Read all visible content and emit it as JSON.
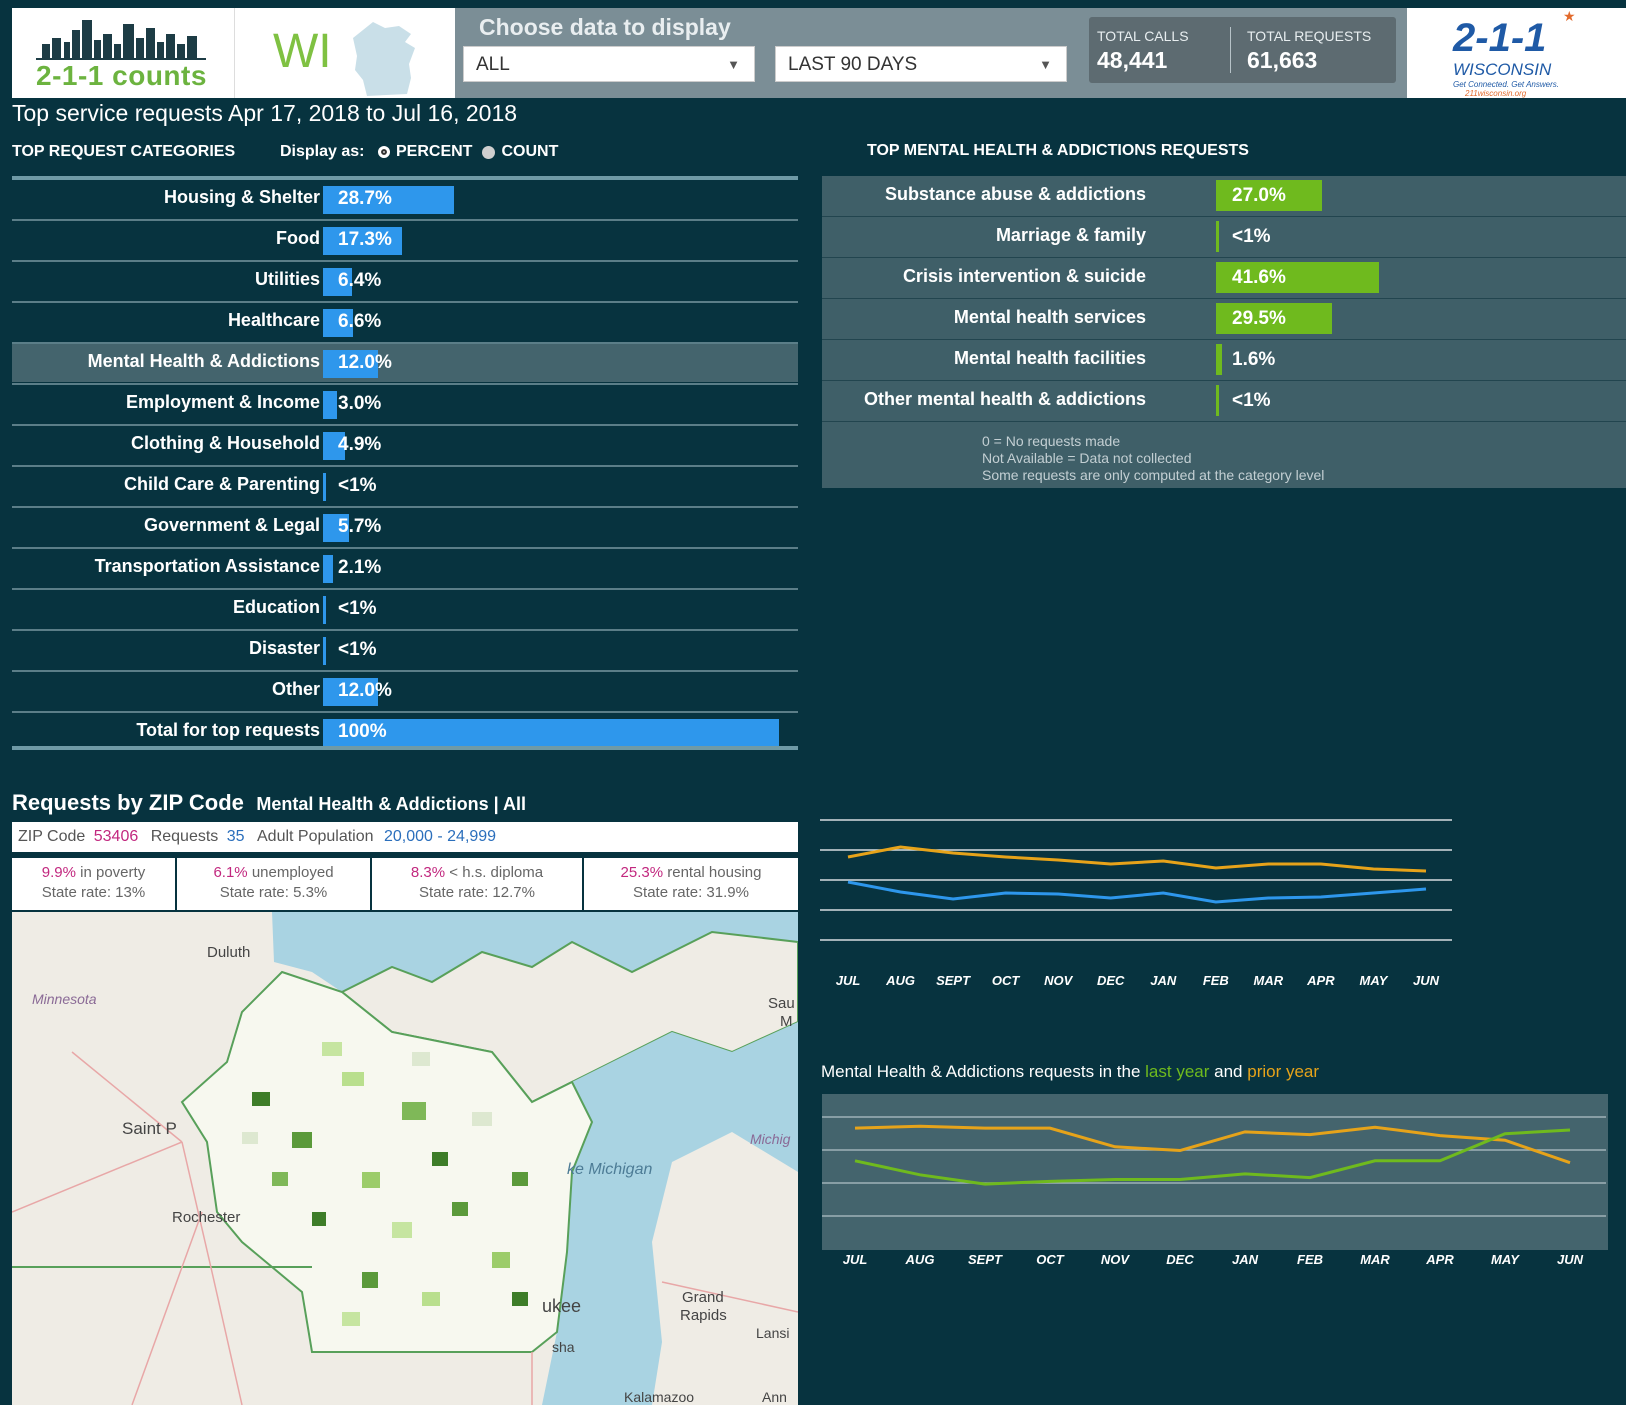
{
  "header": {
    "logo_text": "2-1-1 counts",
    "state_abbr": "WI",
    "choose_label": "Choose data to display",
    "category_select": "ALL",
    "period_select": "LAST 90 DAYS",
    "total_calls_label": "TOTAL CALLS",
    "total_calls_value": "48,441",
    "total_requests_label": "TOTAL REQUESTS",
    "total_requests_value": "61,663",
    "brand_number": "2-1-1",
    "brand_state": "WISCONSIN",
    "brand_tagline": "Get Connected. Get Answers.",
    "brand_url": "211wisconsin.org"
  },
  "page_title": "Top service requests Apr 17, 2018 to Jul 16, 2018",
  "categories_section": {
    "title": "TOP REQUEST CATEGORIES",
    "display_as_label": "Display as:",
    "option_percent": "PERCENT",
    "option_count": "COUNT",
    "selected": "PERCENT",
    "items": [
      {
        "label": "Housing & Shelter",
        "value": "28.7%",
        "fraction": 0.287,
        "highlight": false
      },
      {
        "label": "Food",
        "value": "17.3%",
        "fraction": 0.173,
        "highlight": false
      },
      {
        "label": "Utilities",
        "value": "6.4%",
        "fraction": 0.064,
        "highlight": false
      },
      {
        "label": "Healthcare",
        "value": "6.6%",
        "fraction": 0.066,
        "highlight": false
      },
      {
        "label": "Mental Health & Addictions",
        "value": "12.0%",
        "fraction": 0.12,
        "highlight": true
      },
      {
        "label": "Employment & Income",
        "value": "3.0%",
        "fraction": 0.03,
        "highlight": false
      },
      {
        "label": "Clothing & Household",
        "value": "4.9%",
        "fraction": 0.049,
        "highlight": false
      },
      {
        "label": "Child Care & Parenting",
        "value": "<1%",
        "fraction": 0.005,
        "highlight": false
      },
      {
        "label": "Government & Legal",
        "value": "5.7%",
        "fraction": 0.057,
        "highlight": false
      },
      {
        "label": "Transportation Assistance",
        "value": "2.1%",
        "fraction": 0.021,
        "highlight": false
      },
      {
        "label": "Education",
        "value": "<1%",
        "fraction": 0.005,
        "highlight": false
      },
      {
        "label": "Disaster",
        "value": "<1%",
        "fraction": 0.005,
        "highlight": false
      },
      {
        "label": "Other",
        "value": "12.0%",
        "fraction": 0.12,
        "highlight": false
      },
      {
        "label": "Total for top requests",
        "value": "100%",
        "fraction": 1.0,
        "highlight": false
      }
    ]
  },
  "mental_health_section": {
    "title": "TOP MENTAL HEALTH & ADDICTIONS REQUESTS",
    "items": [
      {
        "label": "Substance abuse & addictions",
        "value": "27.0%",
        "fraction": 0.27
      },
      {
        "label": "Marriage & family",
        "value": "<1%",
        "fraction": 0.005
      },
      {
        "label": "Crisis intervention & suicide",
        "value": "41.6%",
        "fraction": 0.416
      },
      {
        "label": "Mental health services",
        "value": "29.5%",
        "fraction": 0.295
      },
      {
        "label": "Mental health facilities",
        "value": "1.6%",
        "fraction": 0.016
      },
      {
        "label": "Other mental health & addictions",
        "value": "<1%",
        "fraction": 0.005
      }
    ],
    "notes": [
      "0 = No requests made",
      "Not Available = Data not collected",
      "Some requests are only computed at the category level"
    ]
  },
  "zip_section": {
    "title": "Requests by ZIP Code",
    "filter": "Mental Health & Addictions | All",
    "zip_label": "ZIP Code",
    "zip_value": "53406",
    "requests_label": "Requests",
    "requests_value": "35",
    "adult_pop_label": "Adult Population",
    "adult_pop_value": "20,000 - 24,999",
    "stats": [
      {
        "value": "9.9%",
        "label": "in poverty",
        "state": "State rate: 13%"
      },
      {
        "value": "6.1%",
        "label": "unemployed",
        "state": "State rate: 5.3%"
      },
      {
        "value": "8.3%",
        "label": "< h.s. diploma",
        "state": "State rate: 12.7%"
      },
      {
        "value": "25.3%",
        "label": "rental housing",
        "state": "State rate: 31.9%"
      }
    ]
  },
  "map_labels": {
    "duluth": "Duluth",
    "minnesota": "Minnesota",
    "saint_paul": "Saint P",
    "rochester": "Rochester",
    "lake_michigan": "ke Michigan",
    "michigan": "Michig",
    "milwaukee": "ukee",
    "kenosha": "sha",
    "grand_rapids_1": "Grand",
    "grand_rapids_2": "Rapids",
    "lansing": "Lansi",
    "kalamazoo": "Kalamazoo",
    "ann": "Ann",
    "sault_1": "Sau",
    "sault_2": "M"
  },
  "chart_top": {
    "type": "line",
    "categories": [
      "JUL",
      "AUG",
      "SEPT",
      "OCT",
      "NOV",
      "DEC",
      "JAN",
      "FEB",
      "MAR",
      "APR",
      "MAY",
      "JUN"
    ],
    "series": [
      {
        "color": "#e6a31a",
        "values": [
          83,
          93,
          87,
          83,
          80,
          76,
          79,
          72,
          76,
          76,
          71,
          69
        ]
      },
      {
        "color": "#2e97ec",
        "values": [
          58,
          48,
          41,
          47,
          46,
          42,
          47,
          38,
          42,
          43,
          47,
          51
        ]
      }
    ],
    "ylim": [
      0,
      120
    ],
    "grid": true
  },
  "chart_bottom": {
    "type": "line",
    "title_prefix": "Mental Health & Addictions requests in the",
    "title_last": "last year",
    "title_and": "and",
    "title_prior": "prior year",
    "categories": [
      "JUL",
      "AUG",
      "SEPT",
      "OCT",
      "NOV",
      "DEC",
      "JAN",
      "FEB",
      "MAR",
      "APR",
      "MAY",
      "JUN"
    ],
    "series": [
      {
        "name": "prior year",
        "color": "#e6a31a",
        "values": [
          122,
          124,
          122,
          122,
          102,
          98,
          118,
          115,
          123,
          114,
          109,
          85
        ]
      },
      {
        "name": "last year",
        "color": "#6fba1e",
        "values": [
          87,
          72,
          62,
          65,
          67,
          67,
          73,
          69,
          87,
          87,
          116,
          120
        ]
      }
    ],
    "ylim": [
      0,
      150
    ],
    "grid": true
  },
  "colors": {
    "background": "#07333f",
    "category_bar": "#2e97ec",
    "mh_bar": "#6fba1e",
    "highlight_row": "#44646d",
    "logo_green": "#6cb33f",
    "brand_blue": "#1f5aa6"
  }
}
